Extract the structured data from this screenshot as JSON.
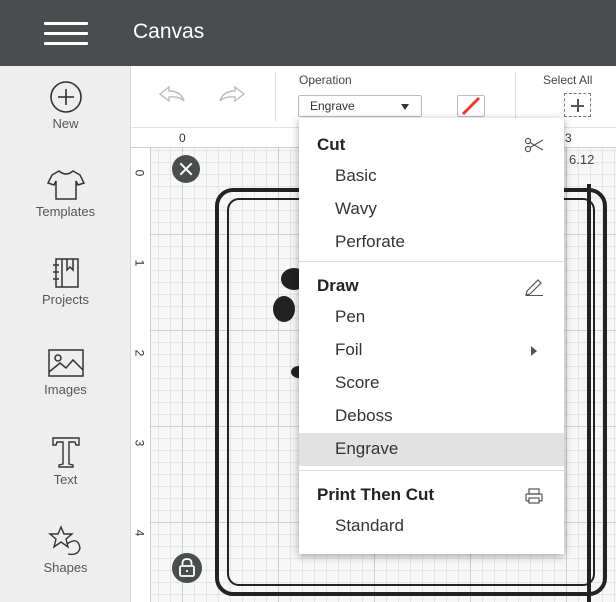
{
  "header": {
    "title": "Canvas"
  },
  "sidebar": {
    "items": [
      {
        "label": "New",
        "icon": "plus-circle-icon"
      },
      {
        "label": "Templates",
        "icon": "tshirt-icon"
      },
      {
        "label": "Projects",
        "icon": "projects-icon"
      },
      {
        "label": "Images",
        "icon": "image-icon"
      },
      {
        "label": "Text",
        "icon": "text-icon"
      },
      {
        "label": "Shapes",
        "icon": "shapes-icon"
      }
    ]
  },
  "toolbar": {
    "operation_label": "Operation",
    "operation_value": "Engrave",
    "select_all_label": "Select All"
  },
  "canvas": {
    "ruler_top": [
      "0",
      "3"
    ],
    "ruler_left": [
      "0",
      "1",
      "2",
      "3",
      "4"
    ],
    "dimension_label": "6.12"
  },
  "operation_menu": {
    "sections": [
      {
        "title": "Cut",
        "icon": "scissors-icon",
        "items": [
          "Basic",
          "Wavy",
          "Perforate"
        ]
      },
      {
        "title": "Draw",
        "icon": "pen-icon",
        "items": [
          "Pen",
          "Foil",
          "Score",
          "Deboss",
          "Engrave"
        ]
      },
      {
        "title": "Print Then Cut",
        "icon": "printer-icon",
        "items": [
          "Standard"
        ]
      }
    ],
    "selected": "Engrave"
  },
  "colors": {
    "topbar": "#4a4d4e",
    "accent_line": "#e63b2e",
    "selected_row": "#e2e2e2"
  }
}
